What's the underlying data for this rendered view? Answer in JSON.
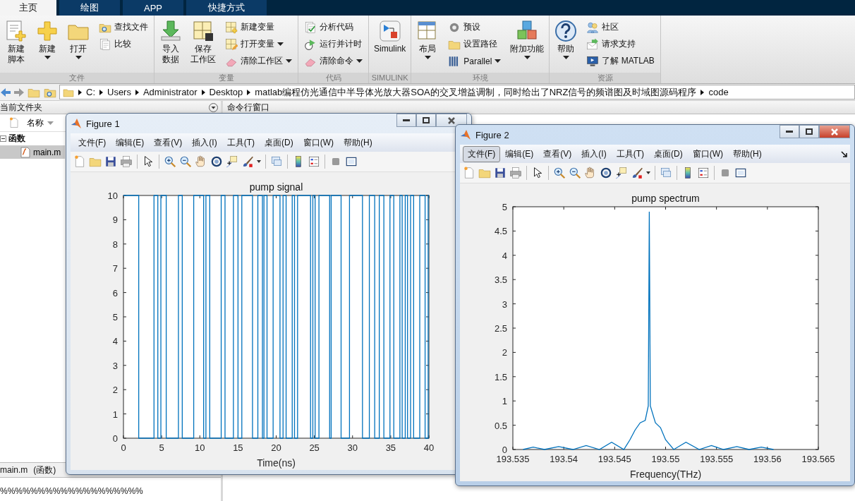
{
  "tabs": [
    {
      "label": "主页",
      "selected": true
    },
    {
      "label": "绘图",
      "selected": false
    },
    {
      "label": "APP",
      "selected": false
    },
    {
      "label": "快捷方式",
      "selected": false
    }
  ],
  "ribbon": {
    "sections": [
      {
        "label": "文件",
        "items": [
          {
            "kind": "large",
            "lines": [
              "新建",
              "脚本"
            ],
            "dropdown": false
          },
          {
            "kind": "large",
            "lines": [
              "新建"
            ],
            "dropdown": true
          },
          {
            "kind": "large",
            "lines": [
              "打开"
            ],
            "dropdown": true
          },
          {
            "kind": "stack",
            "items": [
              {
                "label": "查找文件",
                "dropdown": false
              },
              {
                "label": "比较",
                "dropdown": false
              }
            ]
          }
        ]
      },
      {
        "label": "变量",
        "items": [
          {
            "kind": "large",
            "lines": [
              "导入",
              "数据"
            ],
            "dropdown": false
          },
          {
            "kind": "large",
            "lines": [
              "保存",
              "工作区"
            ],
            "dropdown": false
          },
          {
            "kind": "stack",
            "items": [
              {
                "label": "新建变量",
                "dropdown": false
              },
              {
                "label": "打开变量",
                "dropdown": true
              },
              {
                "label": "清除工作区",
                "dropdown": true
              }
            ]
          }
        ]
      },
      {
        "label": "代码",
        "items": [
          {
            "kind": "stack",
            "items": [
              {
                "label": "分析代码",
                "dropdown": false
              },
              {
                "label": "运行并计时",
                "dropdown": false
              },
              {
                "label": "清除命令",
                "dropdown": true
              }
            ]
          }
        ]
      },
      {
        "label": "SIMULINK",
        "items": [
          {
            "kind": "large",
            "lines": [
              "Simulink"
            ],
            "dropdown": false
          }
        ]
      },
      {
        "label": "环境",
        "items": [
          {
            "kind": "large",
            "lines": [
              "布局"
            ],
            "dropdown": true
          },
          {
            "kind": "stack",
            "items": [
              {
                "label": "预设",
                "dropdown": false
              },
              {
                "label": "设置路径",
                "dropdown": false
              },
              {
                "label": "Parallel",
                "dropdown": true
              }
            ]
          },
          {
            "kind": "large",
            "lines": [
              "附加功能"
            ],
            "dropdown": true
          }
        ]
      },
      {
        "label": "资源",
        "items": [
          {
            "kind": "large",
            "lines": [
              "帮助"
            ],
            "dropdown": true
          },
          {
            "kind": "stack",
            "items": [
              {
                "label": "社区",
                "dropdown": false
              },
              {
                "label": "请求支持",
                "dropdown": false
              },
              {
                "label": "了解 MATLAB",
                "dropdown": false
              }
            ]
          }
        ]
      }
    ]
  },
  "address_bar": {
    "segments": [
      "C:",
      "Users",
      "Administrator",
      "Desktop",
      "matlab编程仿光通信中半导体光放大器SOA的交叉增益调制，同时给出了NRZ信号的频谱图及时域图源码程序",
      "code"
    ]
  },
  "current_folder": {
    "title": "当前文件夹",
    "column": "名称",
    "tree": [
      {
        "label": "函数",
        "expanded": true,
        "children": [
          {
            "label": "main.m",
            "selected": true
          }
        ]
      }
    ],
    "details": {
      "file": "main.m",
      "type": "(函数)"
    },
    "preview": "%%%%%%%%%%%%%%%%%%%"
  },
  "command_window": {
    "title": "命令行窗口"
  },
  "figures": [
    {
      "title": "Figure 1",
      "active": false,
      "menu": [
        {
          "label": "文件(F)",
          "selected": false
        },
        {
          "label": "编辑(E)",
          "selected": false
        },
        {
          "label": "查看(V)",
          "selected": false
        },
        {
          "label": "插入(I)",
          "selected": false
        },
        {
          "label": "工具(T)",
          "selected": false
        },
        {
          "label": "桌面(D)",
          "selected": false
        },
        {
          "label": "窗口(W)",
          "selected": false
        },
        {
          "label": "帮助(H)",
          "selected": false
        }
      ],
      "chart_data": {
        "type": "line",
        "title": "pump signal",
        "xlabel": "Time(ns)",
        "xlim": [
          0,
          40
        ],
        "ylim": [
          0,
          10
        ],
        "xticks": [
          0,
          5,
          10,
          15,
          20,
          25,
          30,
          35,
          40
        ],
        "yticks": [
          0,
          1,
          2,
          3,
          4,
          5,
          6,
          7,
          8,
          9,
          10
        ],
        "x": [
          0,
          2,
          2,
          4,
          4,
          4.5,
          4.5,
          4.9,
          4.9,
          5.6,
          5.6,
          7.2,
          7.2,
          7.7,
          7.7,
          9.2,
          9.2,
          10.5,
          10.5,
          10.8,
          10.8,
          11.3,
          11.3,
          12.8,
          12.8,
          13.3,
          13.3,
          14.4,
          14.4,
          15,
          15,
          15.5,
          15.5,
          16.9,
          16.9,
          17.6,
          17.6,
          18.2,
          18.2,
          18.4,
          18.4,
          18.8,
          18.8,
          19.6,
          19.6,
          20.5,
          20.5,
          20.9,
          20.9,
          21.3,
          21.3,
          22.1,
          22.1,
          22.4,
          22.4,
          22.8,
          22.8,
          24.5,
          24.5,
          24.8,
          24.8,
          25.1,
          25.1,
          25.6,
          25.6,
          27,
          27,
          27.2,
          27.2,
          28.5,
          28.5,
          29.6,
          29.6,
          31.3,
          31.3,
          32.2,
          32.2,
          32.9,
          32.9,
          33.5,
          33.5,
          34.1,
          34.1,
          34.9,
          34.9,
          35.4,
          35.4,
          36.2,
          36.2,
          36.5,
          36.5,
          36.9,
          36.9,
          37.2,
          37.2,
          37.6,
          37.6,
          38,
          38,
          38.8,
          38.8,
          39.5,
          39.5,
          39.9,
          39.9,
          40
        ],
        "series": [
          {
            "color": "#0072bd",
            "values": [
              10,
              10,
              0,
              0,
              10,
              10,
              0,
              0,
              10,
              10,
              0,
              0,
              10,
              10,
              0,
              0,
              10,
              10,
              0,
              0,
              10,
              10,
              0,
              0,
              10,
              10,
              0,
              0,
              10,
              10,
              0,
              0,
              10,
              10,
              0,
              0,
              10,
              10,
              0,
              0,
              10,
              10,
              0,
              0,
              10,
              10,
              0,
              0,
              10,
              10,
              0,
              0,
              10,
              10,
              0,
              0,
              10,
              10,
              0,
              0,
              10,
              10,
              0,
              0,
              10,
              10,
              0,
              0,
              10,
              10,
              0,
              0,
              10,
              10,
              0,
              0,
              10,
              10,
              0,
              0,
              10,
              10,
              0,
              0,
              10,
              10,
              0,
              0,
              10,
              10,
              0,
              0,
              10,
              10,
              0,
              0,
              10,
              10,
              0,
              0,
              10,
              10,
              0,
              0,
              10,
              10
            ]
          }
        ]
      }
    },
    {
      "title": "Figure 2",
      "active": true,
      "menu": [
        {
          "label": "文件(F)",
          "selected": true
        },
        {
          "label": "编辑(E)",
          "selected": false
        },
        {
          "label": "查看(V)",
          "selected": false
        },
        {
          "label": "插入(I)",
          "selected": false
        },
        {
          "label": "工具(T)",
          "selected": false
        },
        {
          "label": "桌面(D)",
          "selected": false
        },
        {
          "label": "窗口(W)",
          "selected": false
        },
        {
          "label": "帮助(H)",
          "selected": false
        }
      ],
      "chart_data": {
        "type": "line",
        "title": "pump spectrum",
        "xlabel": "Frequency(THz)",
        "xlim": [
          193.535,
          193.565
        ],
        "ylim": [
          0,
          5
        ],
        "xticks": [
          193.535,
          193.54,
          193.545,
          193.55,
          193.555,
          193.56,
          193.565
        ],
        "yticks": [
          0,
          0.5,
          1,
          1.5,
          2,
          2.5,
          3,
          3.5,
          4,
          4.5,
          5
        ],
        "x": [
          193.536,
          193.537,
          193.5381,
          193.5395,
          193.5409,
          193.5422,
          193.5435,
          193.5447,
          193.5459,
          193.5465,
          193.547,
          193.5475,
          193.548,
          193.5483,
          193.5484,
          193.5485,
          193.549,
          193.5495,
          193.55,
          193.5508,
          193.552,
          193.5533,
          193.5545,
          193.5557,
          193.557,
          193.5582,
          193.5594,
          193.5606
        ],
        "series": [
          {
            "color": "#0072bd",
            "values": [
              0,
              0.05,
              0,
              0.06,
              0,
              0.08,
              0,
              0.15,
              0,
              0.2,
              0.4,
              0.55,
              0.6,
              0.9,
              4.9,
              0.9,
              0.55,
              0.45,
              0.2,
              0,
              0.15,
              0,
              0.08,
              0,
              0.06,
              0,
              0.05,
              0
            ]
          }
        ]
      }
    }
  ]
}
